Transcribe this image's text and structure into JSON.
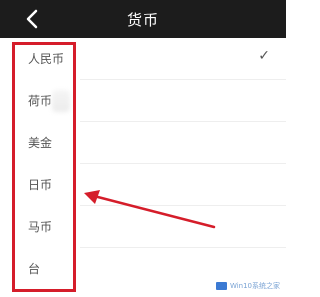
{
  "header": {
    "title": "货币",
    "back_icon": "chevron-left-icon"
  },
  "currencies": [
    {
      "label": "人民币",
      "selected": true
    },
    {
      "label": "荷币",
      "selected": false
    },
    {
      "label": "美金",
      "selected": false
    },
    {
      "label": "日币",
      "selected": false
    },
    {
      "label": "马币",
      "selected": false
    },
    {
      "label": "台",
      "selected": false
    }
  ],
  "check_glyph": "✓",
  "annotation": {
    "box_color": "#d51d2a",
    "arrow_color": "#d51d2a"
  },
  "watermark": {
    "text": "Win10系统之家"
  }
}
